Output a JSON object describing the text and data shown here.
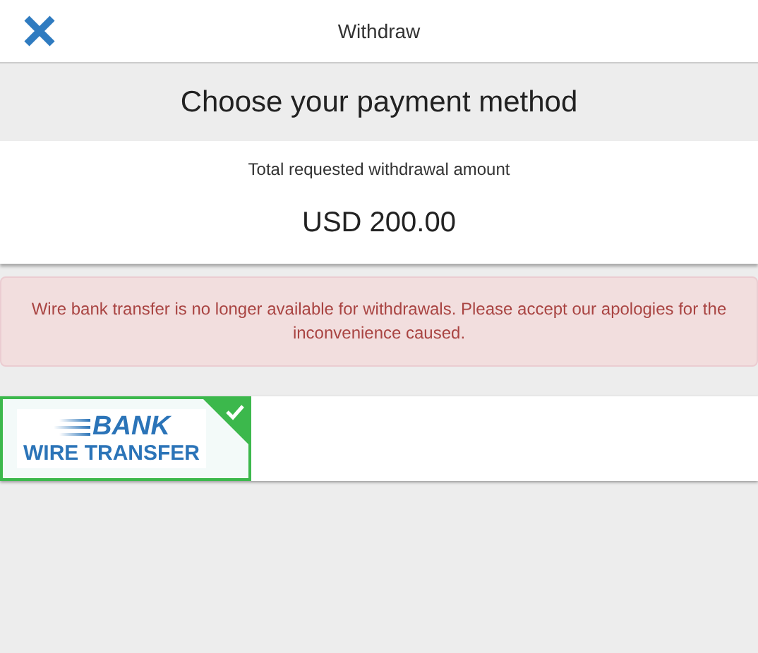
{
  "header": {
    "title": "Withdraw"
  },
  "heading": "Choose your payment method",
  "summary": {
    "label": "Total requested withdrawal amount",
    "amount": "USD 200.00"
  },
  "alert": {
    "text": "Wire bank transfer is no longer available for withdrawals. Please accept our apologies for the inconvenience caused."
  },
  "methods": [
    {
      "line_1": "BANK",
      "line_2": "WIRE TRANSFER",
      "selected": true
    }
  ]
}
